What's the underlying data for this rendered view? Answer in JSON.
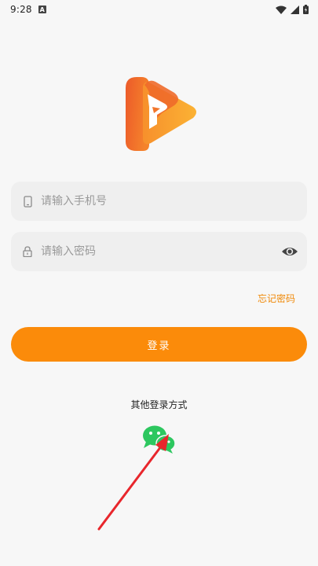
{
  "status_bar": {
    "time": "9:28",
    "notification_letter": "A"
  },
  "logo": {
    "icon": "play-p-logo",
    "colors": [
      "#ef5b2a",
      "#f9a22b"
    ]
  },
  "login_form": {
    "phone_placeholder": "请输入手机号",
    "password_placeholder": "请输入密码",
    "forgot_password": "忘记密码",
    "login_label": "登录"
  },
  "other_login": {
    "label": "其他登录方式",
    "wechat_icon": "wechat-icon"
  },
  "colors": {
    "accent": "#fb8b0a",
    "forgot_text": "#f08a0a",
    "wechat": "#2dc75f",
    "arrow": "#e8262c"
  }
}
